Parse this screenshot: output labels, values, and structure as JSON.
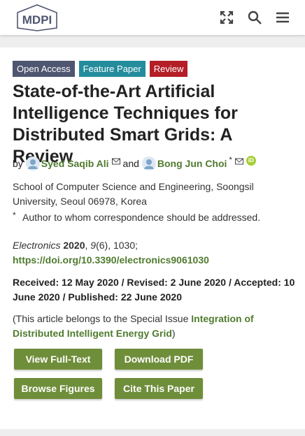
{
  "header": {
    "logo_text": "MDPI",
    "icons": [
      "expand-icon",
      "search-icon",
      "menu-icon"
    ]
  },
  "badges": {
    "open_access": "Open Access",
    "feature_paper": "Feature Paper",
    "review": "Review"
  },
  "article": {
    "title": "State-of-the-Art Artificial Intelligence Techniques for Distributed Smart Grids: A Review",
    "by": "by",
    "author1": "Syed Saqib Ali",
    "and": "and",
    "author2": "Bong Jun Choi",
    "author2_mark": "*",
    "orcid_label": "iD",
    "affiliation": "School of Computer Science and Engineering, Soongsil University, Seoul 06978, Korea",
    "correspondence_mark": "*",
    "correspondence": "Author to whom correspondence should be addressed.",
    "journal_name": "Electronics",
    "journal_year": "2020",
    "journal_volume": "9",
    "journal_rest": "(6), 1030;",
    "doi": "https://doi.org/10.3390/electronics9061030",
    "dates": "Received: 12 May 2020 / Revised: 2 June 2020 / Accepted: 10 June 2020 / Published: 22 June 2020",
    "special_prefix": "(This article belongs to the Special Issue ",
    "special_issue": "Integration of Distributed Intelligent Energy Grid",
    "special_suffix": ")"
  },
  "buttons": {
    "view_full_text": "View Full-Text",
    "download_pdf": "Download PDF",
    "browse_figures": "Browse Figures",
    "cite_paper": "Cite This Paper"
  },
  "colors": {
    "accent_green": "#4f7b2e",
    "button_green": "#6f8e3a",
    "badge_open_access": "#4f5671",
    "badge_feature": "#248c9c",
    "badge_review": "#b41e27"
  }
}
